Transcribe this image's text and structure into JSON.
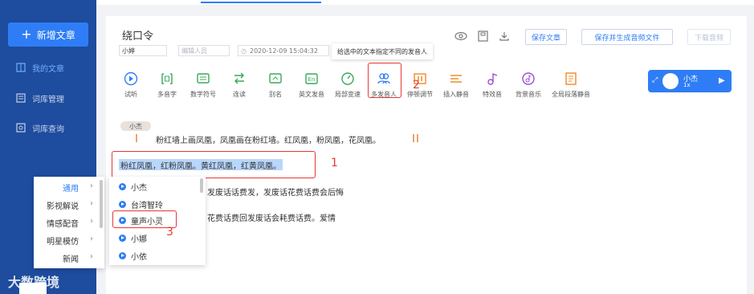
{
  "sidebar": {
    "new_button": "新增文章",
    "items": [
      {
        "label": "我的文章",
        "icon": "book-icon",
        "active": true
      },
      {
        "label": "词库管理",
        "icon": "list-icon",
        "active": false
      },
      {
        "label": "词库查询",
        "icon": "search-doc-icon",
        "active": false
      }
    ]
  },
  "article": {
    "title": "绕口令",
    "author": "小婷",
    "editor_placeholder": "编辑人员",
    "datetime": "2020-12-09 15:04:32"
  },
  "header_buttons": {
    "save": "保存文章",
    "save_generate": "保存并生成音频文件",
    "download": "下载音频"
  },
  "tooltip": "给选中的文本指定不同的发音人",
  "toolbar": [
    {
      "label": "试听",
      "icon": "play-circle-icon"
    },
    {
      "label": "多音字",
      "icon": "polyphone-icon"
    },
    {
      "label": "数字符号",
      "icon": "number-symbol-icon"
    },
    {
      "label": "连读",
      "icon": "linking-icon"
    },
    {
      "label": "别名",
      "icon": "alias-icon"
    },
    {
      "label": "英文发音",
      "icon": "english-icon"
    },
    {
      "label": "局部变速",
      "icon": "speed-icon"
    },
    {
      "label": "多发音人",
      "icon": "multi-speaker-icon"
    },
    {
      "label": "停顿调节",
      "icon": "pause-icon"
    },
    {
      "label": "插入静音",
      "icon": "insert-silence-icon"
    },
    {
      "label": "特效音",
      "icon": "sound-effect-icon"
    },
    {
      "label": "背景音乐",
      "icon": "background-music-icon"
    },
    {
      "label": "全局段落静音",
      "icon": "paragraph-silence-icon"
    }
  ],
  "voice_chip": {
    "name": "小杰",
    "speed": "1x"
  },
  "speaker_tag": "小杰",
  "content": {
    "line1": "粉红墙上画凤凰，凤凰画在粉红墙。红凤凰，粉凤凰，花凤凰。",
    "selected": "粉红凤凰，红粉凤凰。黄红凤凰，红黄凤凰。",
    "line3": "发废话话费发，发废话花费话费会后悔",
    "line4": "花费话费回发废话会耗费话费。爱情"
  },
  "annotations": [
    "1",
    "2",
    "3"
  ],
  "menu_categories": [
    {
      "label": "通用",
      "active": true
    },
    {
      "label": "影视解说",
      "active": false
    },
    {
      "label": "情感配音",
      "active": false
    },
    {
      "label": "明星模仿",
      "active": false
    },
    {
      "label": "新闻",
      "active": false
    }
  ],
  "menu_voices": [
    "小杰",
    "台湾智玲",
    "童声小灵",
    "小娜",
    "小依"
  ],
  "watermark": "大数跨境",
  "colors": {
    "sidebar": "#1e4c9e",
    "accent": "#2f7df6",
    "annotation": "#e53935",
    "selection": "#b9d6fb"
  }
}
